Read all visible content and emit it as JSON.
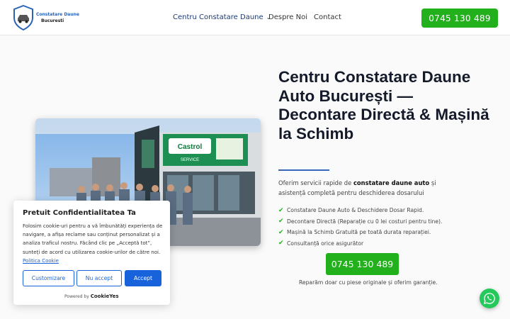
{
  "header": {
    "logo": {
      "line1": "Constatare Daune",
      "line2": "Bucuresti"
    },
    "nav": [
      {
        "label": "Centru Constatare Daune",
        "icon": "chevron-down-icon"
      },
      {
        "label": "Despre Noi"
      },
      {
        "label": "Contact"
      }
    ],
    "phone_button": "0745 130 489"
  },
  "hero": {
    "title": "Centru Constatare Daune Auto București — Decontare Directă & Mașină la Schimb",
    "intro_before": "Oferim servicii rapide de ",
    "intro_bold": "constatare daune auto",
    "intro_after": " și asistență completă pentru deschiderea dosarului",
    "features": [
      "Constatare Daune Auto & Deschidere Dosar Rapid.",
      "Decontare Directă (Reparație cu 0 lei costuri pentru tine).",
      "Mașină la Schimb Gratuită pe toată durata reparației.",
      "Consultanță orice asigurător"
    ],
    "cta": "0745 130 489",
    "guarantee": "Reparăm doar cu piese originale și oferim garanție.",
    "image_sign": "Castrol",
    "image_sign_sub": "SERVICE"
  },
  "cookie": {
    "title": "Pretuit Confidentialitatea Ta",
    "text": "Folosim cookie-uri pentru a vă îmbunătăți experiența de navigare, a afișa reclame sau conținut personalizat și a analiza traficul nostru. Făcând clic pe „Acceptă tot”, sunteți de acord cu utilizarea cookie-urilor de către noi. ",
    "link": "Politica Cookie",
    "buttons": {
      "customize": "Customizare",
      "reject": "Nu accept",
      "accept": "Accept"
    },
    "powered_prefix": "Powered by",
    "powered_brand": "CookieYes"
  },
  "colors": {
    "brand_green": "#22b01c",
    "accent_blue": "#1863dc",
    "title_rule": "#3a64b8"
  },
  "whatsapp": {
    "icon": "whatsapp-icon"
  }
}
